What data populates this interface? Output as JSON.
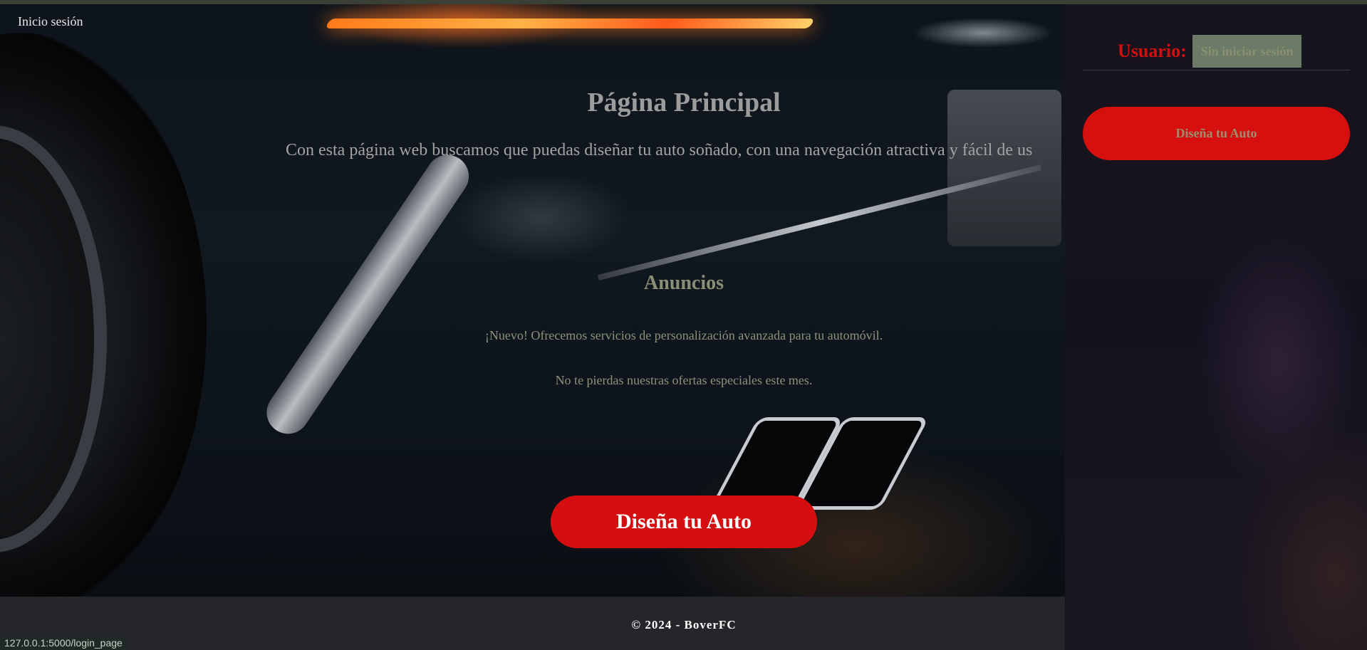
{
  "header": {
    "login_link": "Inicio sesión"
  },
  "main": {
    "title": "Página Principal",
    "intro": "Con esta página web buscamos que puedas diseñar tu auto soñado, con una navegación atractiva y fácil de us",
    "announcements": {
      "title": "Anuncios",
      "items": [
        "¡Nuevo! Ofrecemos servicios de personalización avanzada para tu automóvil.",
        "No te pierdas nuestras ofertas especiales este mes."
      ]
    },
    "cta_label": "Diseña tu Auto"
  },
  "sidebar": {
    "user_label": "Usuario:",
    "user_status": "Sin iniciar sesión",
    "cta_label": "Diseña tu Auto"
  },
  "footer": {
    "text": "© 2024 - BoverFC"
  },
  "status_bar": {
    "url": "127.0.0.1:5000/login_page"
  },
  "colors": {
    "accent_red": "#d50f0f",
    "footer_bg": "#25262a",
    "sidebar_bg": "#17131d"
  }
}
